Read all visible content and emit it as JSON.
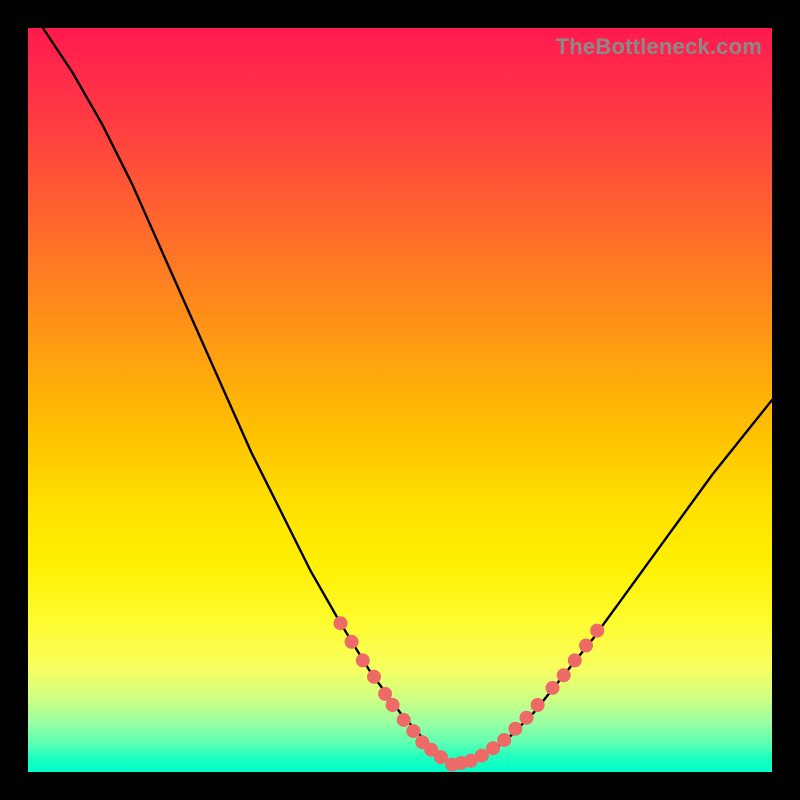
{
  "watermark": "TheBottleneck.com",
  "colors": {
    "background": "#000000",
    "curve_stroke": "#000000",
    "dot_fill": "#ed6a66",
    "gradient_top": "#ff1a4d",
    "gradient_bottom": "#00ffc8"
  },
  "chart_data": {
    "type": "line",
    "title": "",
    "xlabel": "",
    "ylabel": "",
    "xlim": [
      0,
      100
    ],
    "ylim": [
      0,
      100
    ],
    "note": "V-shaped bottleneck curve. Y is bottleneck % (low = green = good). Minimum near x≈57 at y≈0. Left branch starts near (2,100), right branch ends near (100,50). No axis ticks or labels rendered.",
    "series": [
      {
        "name": "bottleneck-curve",
        "x": [
          2,
          6,
          10,
          14,
          18,
          22,
          26,
          30,
          34,
          38,
          42,
          46,
          50,
          54,
          57,
          60,
          64,
          68,
          72,
          76,
          80,
          84,
          88,
          92,
          96,
          100
        ],
        "y": [
          100,
          94,
          87,
          79,
          70,
          61,
          52,
          43,
          35,
          27,
          20,
          13.5,
          8,
          3.5,
          1,
          1.5,
          4,
          8,
          13,
          18,
          23.5,
          29,
          34.5,
          40,
          45,
          50
        ]
      }
    ],
    "highlight_dots": {
      "name": "curve-dots",
      "note": "Salmon bead-like markers clustered near the trough and lower slopes.",
      "points": [
        {
          "x": 42,
          "y": 20
        },
        {
          "x": 43.5,
          "y": 17.5
        },
        {
          "x": 45,
          "y": 15
        },
        {
          "x": 46.5,
          "y": 12.8
        },
        {
          "x": 48,
          "y": 10.5
        },
        {
          "x": 49,
          "y": 9
        },
        {
          "x": 50.5,
          "y": 7
        },
        {
          "x": 51.8,
          "y": 5.5
        },
        {
          "x": 53,
          "y": 4
        },
        {
          "x": 54.2,
          "y": 3
        },
        {
          "x": 55.5,
          "y": 2
        },
        {
          "x": 57,
          "y": 1
        },
        {
          "x": 58.2,
          "y": 1.2
        },
        {
          "x": 59.5,
          "y": 1.5
        },
        {
          "x": 61,
          "y": 2.2
        },
        {
          "x": 62.5,
          "y": 3.2
        },
        {
          "x": 64,
          "y": 4.3
        },
        {
          "x": 65.5,
          "y": 5.8
        },
        {
          "x": 67,
          "y": 7.3
        },
        {
          "x": 68.5,
          "y": 9
        },
        {
          "x": 70.5,
          "y": 11.3
        },
        {
          "x": 72,
          "y": 13
        },
        {
          "x": 73.5,
          "y": 15
        },
        {
          "x": 75,
          "y": 17
        },
        {
          "x": 76.5,
          "y": 19
        }
      ]
    }
  }
}
